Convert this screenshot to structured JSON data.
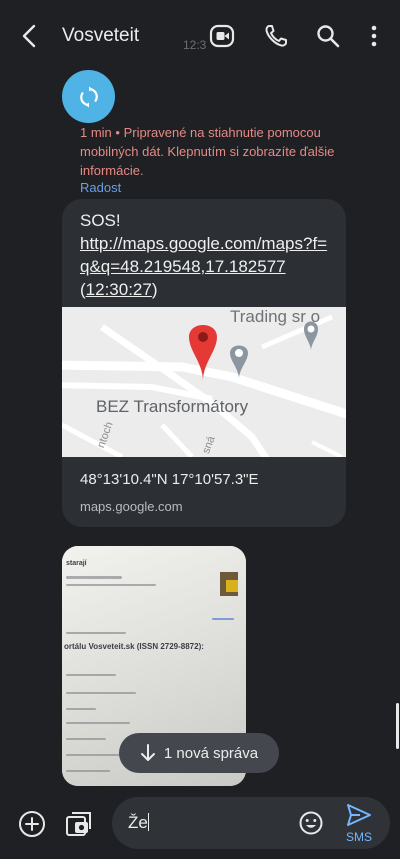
{
  "header": {
    "title": "Vosveteit",
    "ghost_time": "12:3",
    "icons": [
      "back-arrow-icon",
      "video-call-icon",
      "phone-icon",
      "search-icon",
      "more-vert-icon"
    ]
  },
  "thread": {
    "download_notice": "1 min • Pripravené na stiahnutie pomocou mobilných dát. Klepnutím si zobrazíte ďalšie informácie.",
    "sender": "Radost",
    "message": {
      "line1": "SOS!",
      "link": "http://maps.google.com/maps?f=q&q=48.219548,17.182577",
      "time_open": "(",
      "time": "12:30:27",
      "time_close": ")"
    },
    "map_preview": {
      "label_top": "Trading sr o",
      "label_main": "BEZ Transformátory",
      "label_street1": "ntoch",
      "label_street2": "sná",
      "coords": "48°13'10.4\"N 17°10'57.3\"E",
      "domain": "maps.google.com"
    },
    "photo": {
      "text_a": "starají",
      "text_b": "ortálu Vosveteit.sk (ISSN 2729-8872):"
    }
  },
  "new_message_pill": {
    "label": "1 nová správa"
  },
  "composer": {
    "text": "Že",
    "send_label": "SMS"
  },
  "colors": {
    "background": "#1e2024",
    "avatar": "#4fb3e6",
    "notice": "#e58a84",
    "sender": "#6a9fe6",
    "accent": "#74b6ff"
  }
}
